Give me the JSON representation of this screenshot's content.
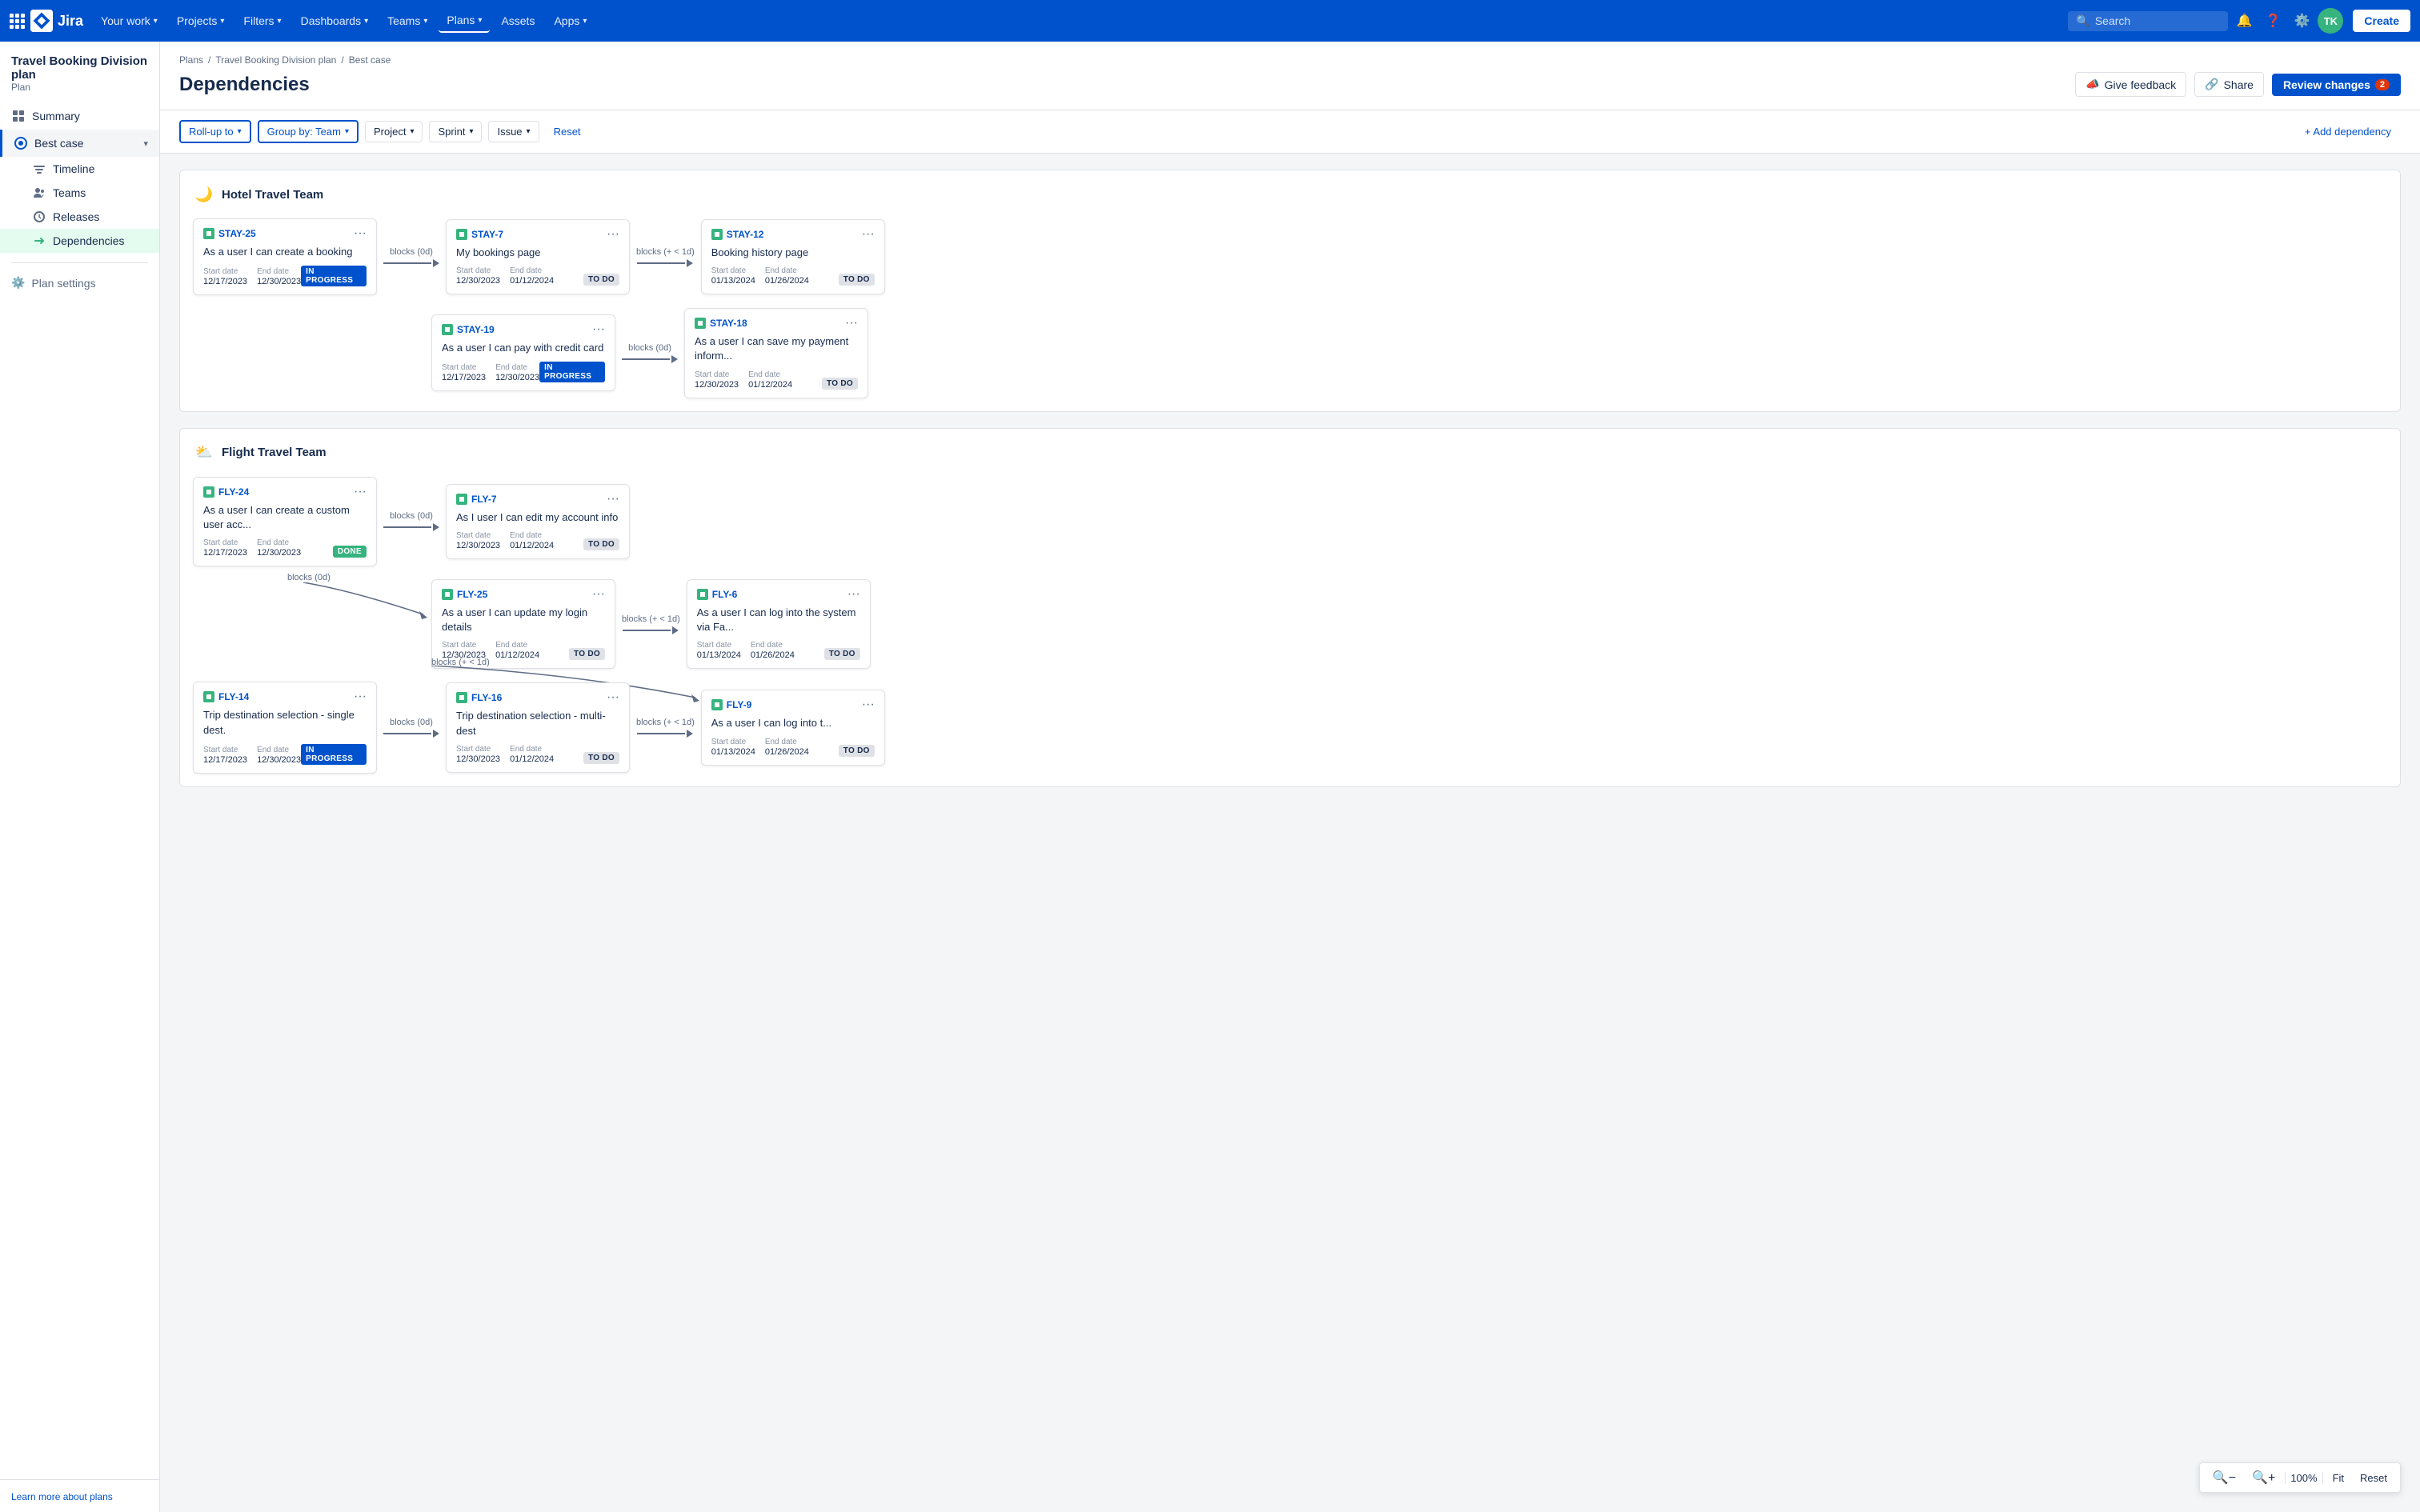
{
  "nav": {
    "logo_text": "Jira",
    "items": [
      {
        "label": "Your work",
        "has_chevron": true
      },
      {
        "label": "Projects",
        "has_chevron": true
      },
      {
        "label": "Filters",
        "has_chevron": true
      },
      {
        "label": "Dashboards",
        "has_chevron": true
      },
      {
        "label": "Teams",
        "has_chevron": true
      },
      {
        "label": "Plans",
        "has_chevron": true,
        "active": true
      },
      {
        "label": "Assets",
        "has_chevron": false
      },
      {
        "label": "Apps",
        "has_chevron": true
      }
    ],
    "search_placeholder": "Search",
    "create_label": "Create",
    "avatar_initials": "TK"
  },
  "sidebar": {
    "plan_name": "Travel Booking Division plan",
    "plan_label": "Plan",
    "items": [
      {
        "label": "Summary",
        "icon": "grid-icon"
      },
      {
        "label": "Best case",
        "icon": "target-icon",
        "active": true,
        "has_chevron": true
      },
      {
        "label": "Timeline",
        "icon": "timeline-icon",
        "sub": true
      },
      {
        "label": "Teams",
        "icon": "teams-icon",
        "sub": true
      },
      {
        "label": "Releases",
        "icon": "release-icon",
        "sub": true
      },
      {
        "label": "Dependencies",
        "icon": "dep-icon",
        "sub": true,
        "active_sub": true
      }
    ],
    "plan_settings_label": "Plan settings",
    "footer_link": "Learn more about plans"
  },
  "breadcrumb": [
    "Plans",
    "Travel Booking Division plan",
    "Best case"
  ],
  "page_title": "Dependencies",
  "actions": {
    "give_feedback_label": "Give feedback",
    "share_label": "Share",
    "review_changes_label": "Review changes",
    "review_changes_badge": "2"
  },
  "filters": {
    "rollup_label": "Roll-up to",
    "group_by_label": "Group by: Team",
    "project_label": "Project",
    "sprint_label": "Sprint",
    "issue_label": "Issue",
    "reset_label": "Reset",
    "add_dep_label": "+ Add dependency"
  },
  "hotel_team": {
    "name": "Hotel Travel Team",
    "emoji": "🌙",
    "rows": [
      {
        "cards": [
          {
            "id": "STAY-25",
            "title": "As a user I can create a booking",
            "start_label": "Start date",
            "start": "12/17/2023",
            "end_label": "End date",
            "end": "12/30/2023",
            "status": "IN PROGRESS",
            "status_type": "in-progress"
          },
          {
            "arrow_label": "blocks (0d)",
            "id": "STAY-7",
            "title": "My bookings page",
            "start_label": "Start date",
            "start": "12/30/2023",
            "end_label": "End date",
            "end": "01/12/2024",
            "status": "TO DO",
            "status_type": "to-do"
          },
          {
            "arrow_label": "blocks (+ < 1d)",
            "id": "STAY-12",
            "title": "Booking history page",
            "start_label": "Start date",
            "start": "01/13/2024",
            "end_label": "End date",
            "end": "01/26/2024",
            "status": "TO DO",
            "status_type": "to-do"
          }
        ]
      },
      {
        "cards": [
          {
            "id": "STAY-19",
            "title": "As a user I can pay with credit card",
            "start_label": "Start date",
            "start": "12/17/2023",
            "end_label": "End date",
            "end": "12/30/2023",
            "status": "IN PROGRESS",
            "status_type": "in-progress",
            "offset": true
          },
          {
            "arrow_label": "blocks (0d)",
            "id": "STAY-18",
            "title": "As a user I can save my payment inform...",
            "start_label": "Start date",
            "start": "12/30/2023",
            "end_label": "End date",
            "end": "01/12/2024",
            "status": "TO DO",
            "status_type": "to-do"
          }
        ]
      }
    ]
  },
  "flight_team": {
    "name": "Flight Travel Team",
    "emoji": "⛅",
    "rows": [
      {
        "cards": [
          {
            "id": "FLY-24",
            "title": "As a user I can create a custom user acc...",
            "start_label": "Start date",
            "start": "12/17/2023",
            "end_label": "End date",
            "end": "12/30/2023",
            "status": "DONE",
            "status_type": "done"
          },
          {
            "arrow_label": "blocks (0d)",
            "id": "FLY-7",
            "title": "As I user I can edit my account info",
            "start_label": "Start date",
            "start": "12/30/2023",
            "end_label": "End date",
            "end": "01/12/2024",
            "status": "TO DO",
            "status_type": "to-do"
          }
        ]
      },
      {
        "cards": [
          {
            "arrow_label": "blocks (0d)",
            "id": "FLY-25",
            "title": "As a user I can update my login details",
            "start_label": "Start date",
            "start": "12/30/2023",
            "end_label": "End date",
            "end": "01/12/2024",
            "status": "TO DO",
            "status_type": "to-do",
            "offset": true
          },
          {
            "arrow_label": "blocks (+ < 1d)",
            "id": "FLY-6",
            "title": "As a user I can log into the system via Fa...",
            "start_label": "Start date",
            "start": "01/13/2024",
            "end_label": "End date",
            "end": "01/26/2024",
            "status": "TO DO",
            "status_type": "to-do"
          }
        ]
      },
      {
        "cards": [
          {
            "id": "FLY-14",
            "title": "Trip destination selection - single dest.",
            "start_label": "Start date",
            "start": "12/17/2023",
            "end_label": "End date",
            "end": "12/30/2023",
            "status": "IN PROGRESS",
            "status_type": "in-progress"
          },
          {
            "arrow_label": "blocks (0d)",
            "id": "FLY-16",
            "title": "Trip destination selection - multi-dest",
            "start_label": "Start date",
            "start": "12/30/2023",
            "end_label": "End date",
            "end": "01/12/2024",
            "status": "TO DO",
            "status_type": "to-do"
          },
          {
            "arrow_label": "blocks (+ < 1d)",
            "id": "FLY-9",
            "title": "As a user I can log into t...",
            "start_label": "Start date",
            "start": "01/13/2024",
            "end_label": "End date",
            "end": "01/26/2024",
            "status": "TO DO",
            "status_type": "to-do"
          }
        ]
      }
    ]
  },
  "zoom": {
    "level": "100%",
    "fit_label": "Fit",
    "reset_label": "Reset"
  }
}
